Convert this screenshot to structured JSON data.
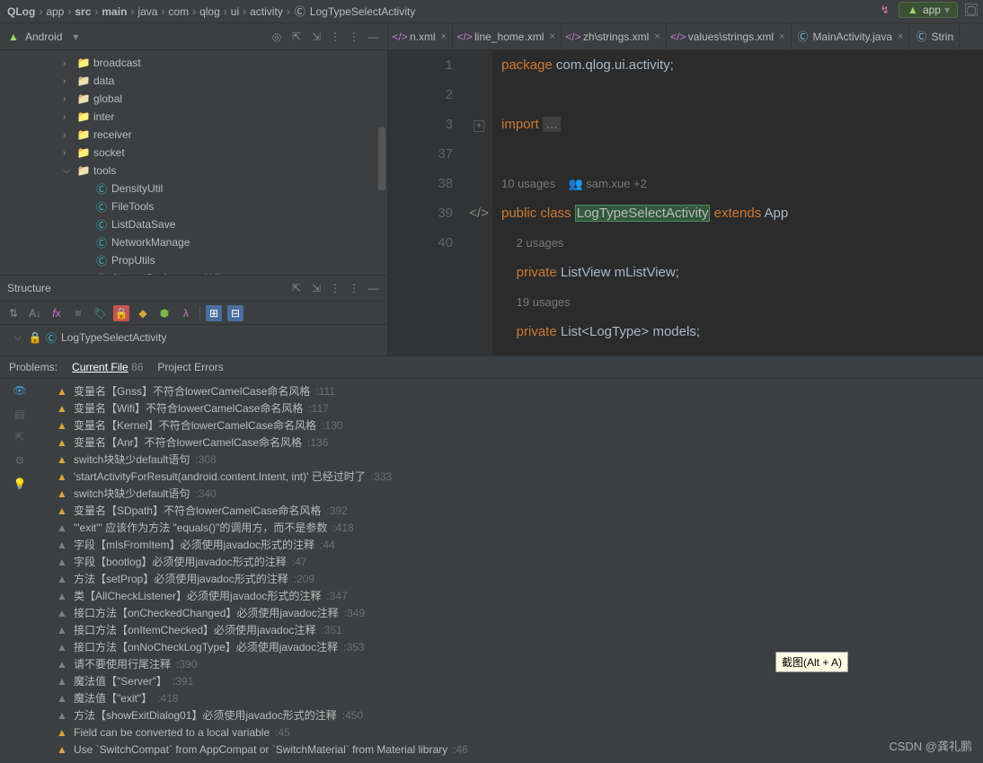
{
  "breadcrumb": [
    "QLog",
    "app",
    "src",
    "main",
    "java",
    "com",
    "qlog",
    "ui",
    "activity",
    "LogTypeSelectActivity"
  ],
  "topbar": {
    "app_label": "app"
  },
  "project": {
    "header": "Android",
    "tree": [
      {
        "icon": "folder",
        "label": "broadcast",
        "indent": 1,
        "chev": ">"
      },
      {
        "icon": "folder-g",
        "label": "data",
        "indent": 1,
        "chev": ">"
      },
      {
        "icon": "folder-g",
        "label": "global",
        "indent": 1,
        "chev": ">"
      },
      {
        "icon": "folder",
        "label": "inter",
        "indent": 1,
        "chev": ">"
      },
      {
        "icon": "folder",
        "label": "receiver",
        "indent": 1,
        "chev": ">"
      },
      {
        "icon": "folder",
        "label": "socket",
        "indent": 1,
        "chev": ">"
      },
      {
        "icon": "folder-g",
        "label": "tools",
        "indent": 1,
        "chev": "v"
      },
      {
        "icon": "class",
        "label": "DensityUtil",
        "indent": 2
      },
      {
        "icon": "class",
        "label": "FileTools",
        "indent": 2
      },
      {
        "icon": "class",
        "label": "ListDataSave",
        "indent": 2
      },
      {
        "icon": "class",
        "label": "NetworkManage",
        "indent": 2
      },
      {
        "icon": "class",
        "label": "PropUtils",
        "indent": 2
      },
      {
        "icon": "class",
        "label": "SharedPreferencesUtil",
        "indent": 2
      }
    ]
  },
  "structure": {
    "header": "Structure",
    "item": "LogTypeSelectActivity"
  },
  "tabs": [
    {
      "icon": "xml",
      "label": "n.xml"
    },
    {
      "icon": "xml",
      "label": "line_home.xml"
    },
    {
      "icon": "xml",
      "label": "zh\\strings.xml"
    },
    {
      "icon": "xml",
      "label": "values\\strings.xml"
    },
    {
      "icon": "java",
      "label": "MainActivity.java"
    },
    {
      "icon": "java",
      "label": "Strin"
    }
  ],
  "code": {
    "lines": [
      {
        "n": "1",
        "html": "<span class='kw'>package</span> <span class='pkg'>com.qlog.ui.activity;</span>"
      },
      {
        "n": "2",
        "html": ""
      },
      {
        "n": "3",
        "html": "<span class='kw'>import</span> <span class='gray' style='background:#404040;padding:0 4px'>...</span>",
        "fold": true
      },
      {
        "n": "37",
        "html": ""
      },
      {
        "n": "",
        "html": "<span class='usage'>10 usages &nbsp;&nbsp; <span style='color:#b389c5'>👥</span> sam.xue +2</span>"
      },
      {
        "n": "38",
        "html": "<span class='kw'>public</span> <span class='kw'>class</span> <span class='hl'>LogTypeSelectActivity</span> <span class='kw'>extends</span> <span class='cls'>App</span>",
        "svg": true
      },
      {
        "n": "",
        "html": "&nbsp;&nbsp;&nbsp;&nbsp;<span class='usage'>2 usages</span>"
      },
      {
        "n": "39",
        "html": "&nbsp;&nbsp;&nbsp;&nbsp;<span class='kw'>private</span> <span class='cls'>ListView</span> <span class='generic'>mListView;</span>"
      },
      {
        "n": "",
        "html": "&nbsp;&nbsp;&nbsp;&nbsp;<span class='usage'>19 usages</span>"
      },
      {
        "n": "40",
        "html": "&nbsp;&nbsp;&nbsp;&nbsp;<span class='kw'>private</span> <span class='cls'>List&lt;LogType&gt;</span> <span class='generic'>models;</span>"
      }
    ]
  },
  "problems": {
    "header": "Problems:",
    "current": "Current File",
    "count": "86",
    "errors_tab": "Project Errors",
    "items": [
      {
        "t": "w",
        "msg": "变量名【Gnss】不符合lowerCamelCase命名风格",
        "ln": ":111"
      },
      {
        "t": "w",
        "msg": "变量名【Wifi】不符合lowerCamelCase命名风格",
        "ln": ":117"
      },
      {
        "t": "w",
        "msg": "变量名【Kernel】不符合lowerCamelCase命名风格",
        "ln": ":130"
      },
      {
        "t": "w",
        "msg": "变量名【Anr】不符合lowerCamelCase命名风格",
        "ln": ":136"
      },
      {
        "t": "w",
        "msg": "switch块缺少default语句",
        "ln": ":308"
      },
      {
        "t": "w",
        "msg": "'startActivityForResult(android.content.Intent, int)' 已经过时了",
        "ln": ":333"
      },
      {
        "t": "w",
        "msg": "switch块缺少default语句",
        "ln": ":340"
      },
      {
        "t": "w",
        "msg": "变量名【SDpath】不符合lowerCamelCase命名风格",
        "ln": ":392"
      },
      {
        "t": "g",
        "msg": "'\"exit\"' 应该作为方法 \"equals()\"的调用方，而不是参数",
        "ln": ":418"
      },
      {
        "t": "g",
        "msg": "字段【mIsFromItem】必须使用javadoc形式的注释",
        "ln": ":44"
      },
      {
        "t": "g",
        "msg": "字段【bootlog】必须使用javadoc形式的注释",
        "ln": ":47"
      },
      {
        "t": "g",
        "msg": "方法【setProp】必须使用javadoc形式的注释",
        "ln": ":209"
      },
      {
        "t": "g",
        "msg": "类【AllCheckListener】必须使用javadoc形式的注释",
        "ln": ":347"
      },
      {
        "t": "g",
        "msg": "接口方法【onCheckedChanged】必须使用javadoc注释",
        "ln": ":349"
      },
      {
        "t": "g",
        "msg": "接口方法【onItemChecked】必须使用javadoc注释",
        "ln": ":351"
      },
      {
        "t": "g",
        "msg": "接口方法【onNoCheckLogType】必须使用javadoc注释",
        "ln": ":353"
      },
      {
        "t": "g",
        "msg": "请不要使用行尾注释",
        "ln": ":390"
      },
      {
        "t": "g",
        "msg": "魔法值【\"Server\"】",
        "ln": ":391"
      },
      {
        "t": "g",
        "msg": "魔法值【\"exit\"】",
        "ln": ":418"
      },
      {
        "t": "g",
        "msg": "方法【showExitDialog01】必须使用javadoc形式的注释",
        "ln": ":450"
      },
      {
        "t": "w",
        "msg": "Field can be converted to a local variable",
        "ln": ":45"
      },
      {
        "t": "w",
        "msg": "Use `SwitchCompat` from AppCompat or `SwitchMaterial` from Material library",
        "ln": ":46"
      }
    ]
  },
  "tooltip": "截图(Alt + A)",
  "watermark": "CSDN @龚礼鹏"
}
